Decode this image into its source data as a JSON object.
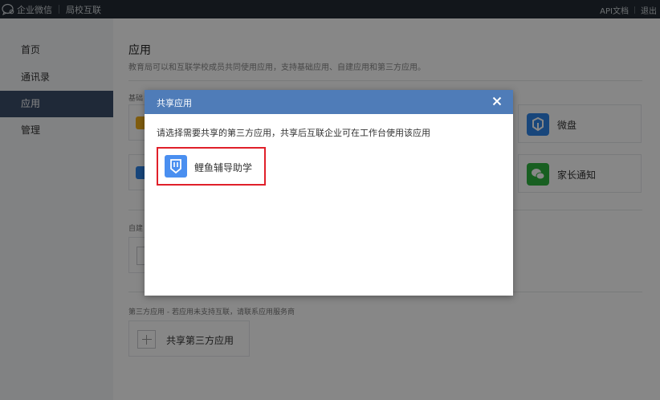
{
  "topbar": {
    "brand": "企业微信",
    "module": "局校互联",
    "api_doc": "API文档",
    "logout": "退出"
  },
  "sidebar": {
    "items": [
      {
        "label": "首页"
      },
      {
        "label": "通讯录"
      },
      {
        "label": "应用"
      },
      {
        "label": "管理"
      }
    ]
  },
  "main": {
    "title": "应用",
    "description": "教育局可以和互联学校成员共同使用应用，支持基础应用、自建应用和第三方应用。",
    "basic_section_label": "基础",
    "basic_apps": [
      {
        "name": "微盘",
        "icon": "weipan-icon",
        "color": "#2f84e8"
      },
      {
        "name": "家长通知",
        "icon": "chat-bubble-icon",
        "color": "#2fb33f"
      }
    ],
    "custom_section_label": "自建",
    "third_party_section_label": "第三方应用 - 若应用未支持互联，请联系应用服务商",
    "add_third_party_label": "共享第三方应用"
  },
  "modal": {
    "title": "共享应用",
    "description": "请选择需要共享的第三方应用，共享后互联企业可在工作台使用该应用",
    "apps": [
      {
        "name": "鲤鱼辅导助学",
        "icon": "bookmark-shield-icon",
        "color": "#4a8ff0",
        "highlight": "#e0202a"
      }
    ]
  }
}
